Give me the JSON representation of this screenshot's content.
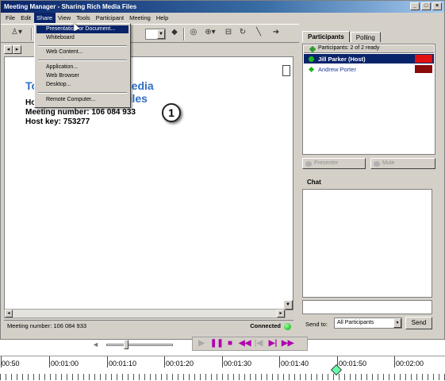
{
  "window": {
    "title": "Meeting Manager - Sharing Rich Media Files"
  },
  "menubar": {
    "items": [
      "File",
      "Edit",
      "Share",
      "View",
      "Tools",
      "Participant",
      "Meeting",
      "Help"
    ]
  },
  "share_menu": {
    "items": [
      "Presentation or Document...",
      "Whiteboard",
      "Web Content...",
      "Application...",
      "Web Browser",
      "Desktop...",
      "Remote Computer..."
    ]
  },
  "document": {
    "title_left": "To",
    "title_right": "Media Files",
    "line1_prefix": "Ho",
    "meeting_number_line": "Meeting number: 106 084 933",
    "host_key_line": "Host key: 753277",
    "callout": "1"
  },
  "status": {
    "meeting_number": "Meeting number: 106 084 933",
    "connection": "Connected"
  },
  "panel": {
    "tabs": [
      "Participants",
      "Polling"
    ],
    "participants_header": "Participants: 2 of 2 ready",
    "participants": [
      {
        "name": "Jill Parker (Host)",
        "flag_color": "#e01010"
      },
      {
        "name": "Andrew Porter",
        "flag_color": "#8b0a0a"
      }
    ],
    "presenter_label": "Presenter",
    "mute_label": "Mute",
    "chat_label": "Chat",
    "send_to_label": "Send to:",
    "send_to_value": "All Participants",
    "send_label": "Send"
  },
  "timeline": {
    "labels": [
      "00:50",
      "00:01:00",
      "00:01:10",
      "00:01:20",
      "00:01:30",
      "00:01:40",
      "00:01:50",
      "00:02:00"
    ]
  },
  "colors": {
    "title_bar": "#0a246a",
    "doc_title": "#2f6fc4",
    "selected_row": "#0a246a",
    "playback_controls": "#b000b0"
  }
}
